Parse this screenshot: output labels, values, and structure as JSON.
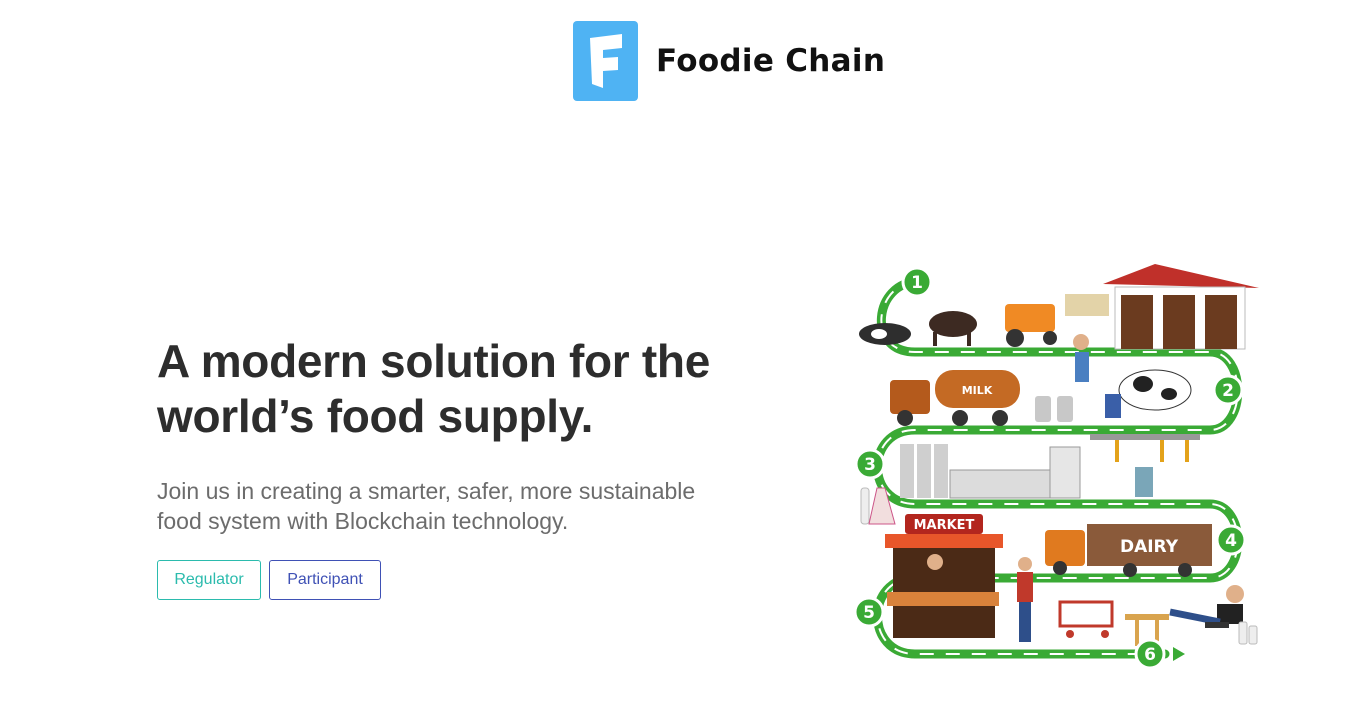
{
  "brand": {
    "name": "Foodie Chain",
    "logo_icon": "foodie-chain-f-logo-icon",
    "logo_color": "#4fb3f3"
  },
  "hero": {
    "title": "A modern solution for the world’s food supply.",
    "subtitle": "Join us in creating a smarter, safer, more sustainable food system with Blockchain technology."
  },
  "buttons": {
    "regulator_label": "Regulator",
    "participant_label": "Participant",
    "regulator_color": "#2bbbad",
    "participant_color": "#3f51b5"
  },
  "illustration": {
    "steps": [
      "1",
      "2",
      "3",
      "4",
      "5",
      "6"
    ],
    "labels": {
      "milk": "MILK",
      "market": "MARKET",
      "dairy": "DAIRY"
    },
    "path_color": "#3aaa35"
  }
}
